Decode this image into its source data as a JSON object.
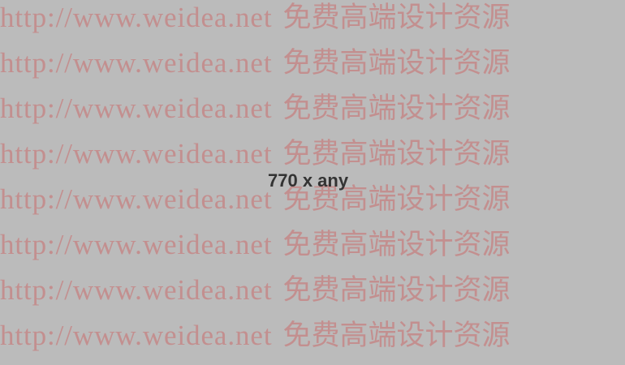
{
  "placeholder": {
    "label": "770 x any",
    "background_color": "#bbbbbb",
    "label_color": "#333333"
  },
  "watermark": {
    "color": "#c38f8f",
    "lines": [
      {
        "url": "http://www.weidea.net",
        "text": "免费高端设计资源"
      },
      {
        "url": "http://www.weidea.net",
        "text": "免费高端设计资源"
      },
      {
        "url": "http://www.weidea.net",
        "text": "免费高端设计资源"
      },
      {
        "url": "http://www.weidea.net",
        "text": "免费高端设计资源"
      },
      {
        "url": "http://www.weidea.net",
        "text": "免费高端设计资源"
      },
      {
        "url": "http://www.weidea.net",
        "text": "免费高端设计资源"
      },
      {
        "url": "http://www.weidea.net",
        "text": "免费高端设计资源"
      },
      {
        "url": "http://www.weidea.net",
        "text": "免费高端设计资源"
      }
    ]
  }
}
